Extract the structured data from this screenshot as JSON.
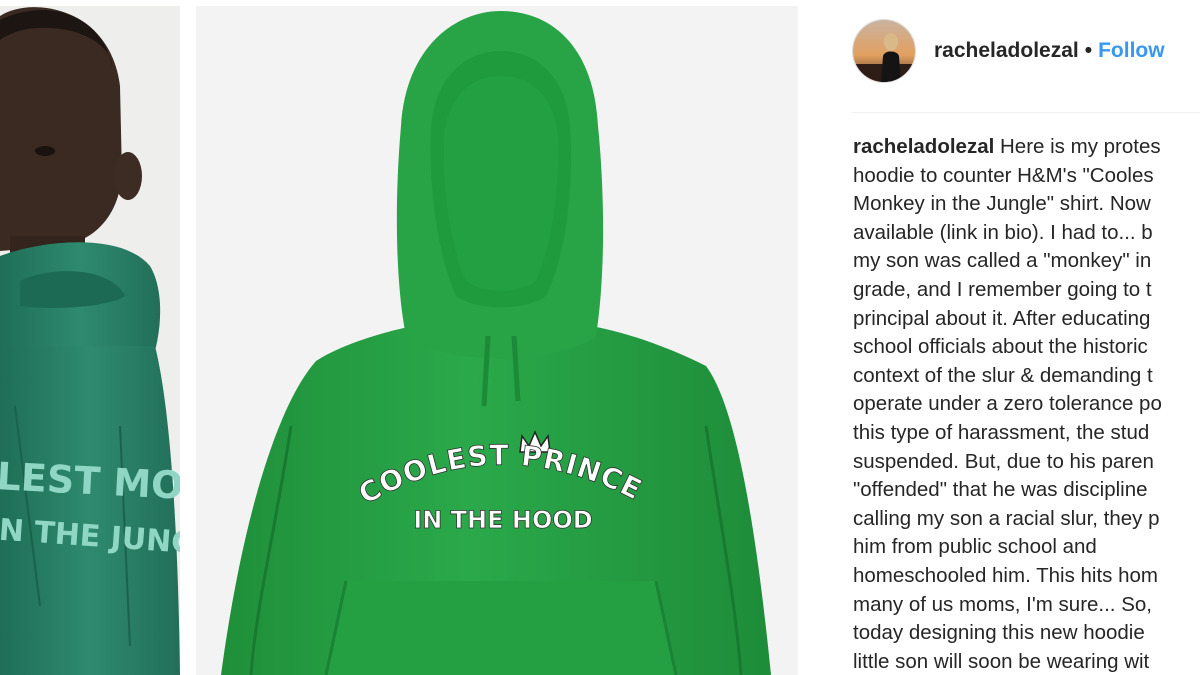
{
  "post": {
    "username": "racheladolezal",
    "separator": "•",
    "follow_label": "Follow",
    "caption_lines": [
      "Here is my protes",
      "hoodie to counter H&M's \"Cooles",
      "Monkey in the Jungle\" shirt. Now",
      "available (link in bio). I had to... b",
      "my son was called a \"monkey\" in",
      "grade, and I remember going to t",
      "principal about it. After educating",
      "school officials about the historic",
      "context of the slur & demanding t",
      "operate under a zero tolerance po",
      "this type of harassment, the stud",
      "suspended. But, due to his paren",
      "\"offended\" that he was discipline",
      "calling my son a racial slur, they p",
      "him from public school and",
      "homeschooled him. This hits hom",
      "many of us moms, I'm sure... So,",
      "today designing this new hoodie",
      "little son will soon be wearing wit"
    ]
  },
  "left_photo": {
    "shirt_text_line1": "LEST MONKE",
    "shirt_text_line2": "N THE JUNGLE"
  },
  "hoodie_photo": {
    "text_line1": "COOLEST PRINCE",
    "text_line2": "IN THE HOOD"
  },
  "colors": {
    "follow": "#3897f0",
    "text": "#262626",
    "hoodie_green": "#25a244",
    "left_hoodie_teal": "#2f8b70"
  }
}
